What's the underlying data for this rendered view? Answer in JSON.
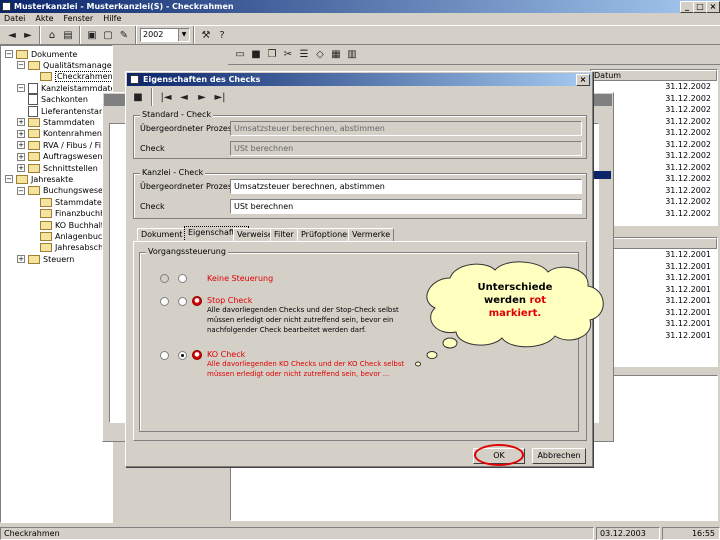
{
  "app": {
    "title": "Musterkanzlei - Musterkanzlei(S) - Checkrahmen",
    "menu": [
      "Datei",
      "Akte",
      "Fenster",
      "Hilfe"
    ],
    "year_select": "2002",
    "window_controls": [
      "_",
      "□",
      "×"
    ]
  },
  "tree": [
    {
      "label": "Dokumente",
      "level": 0,
      "type": "folder",
      "exp": "−"
    },
    {
      "label": "Qualitätsmanagement",
      "level": 1,
      "type": "folder",
      "exp": "−"
    },
    {
      "label": "Checkrahmen",
      "level": 2,
      "type": "folder",
      "exp": "",
      "selected": true
    },
    {
      "label": "Kanzleistammdaten",
      "level": 1,
      "type": "doc",
      "exp": "−"
    },
    {
      "label": "Sachkonten",
      "level": 1,
      "type": "doc",
      "exp": ""
    },
    {
      "label": "Lieferantenstamm",
      "level": 1,
      "type": "doc",
      "exp": ""
    },
    {
      "label": "Stammdaten",
      "level": 1,
      "type": "folder",
      "exp": "+"
    },
    {
      "label": "Kontenrahmen",
      "level": 1,
      "type": "folder",
      "exp": "+"
    },
    {
      "label": "RVA / Fibus / Fi",
      "level": 1,
      "type": "folder",
      "exp": "+"
    },
    {
      "label": "Auftragswesen",
      "level": 1,
      "type": "folder",
      "exp": "+"
    },
    {
      "label": "Schnittstellen",
      "level": 1,
      "type": "folder",
      "exp": "+"
    },
    {
      "label": "Jahresakte",
      "level": 0,
      "type": "folder",
      "exp": "−"
    },
    {
      "label": "Buchungswesen",
      "level": 1,
      "type": "folder",
      "exp": "−"
    },
    {
      "label": "Stammdaten",
      "level": 2,
      "type": "folder",
      "exp": ""
    },
    {
      "label": "Finanzbuchhaltung",
      "level": 2,
      "type": "folder",
      "exp": ""
    },
    {
      "label": "KO Buchhaltung",
      "level": 2,
      "type": "folder",
      "exp": ""
    },
    {
      "label": "Anlagenbuchhaltung",
      "level": 2,
      "type": "folder",
      "exp": ""
    },
    {
      "label": "Jahresabschluss",
      "level": 2,
      "type": "folder",
      "exp": ""
    },
    {
      "label": "Steuern",
      "level": 1,
      "type": "folder",
      "exp": "+"
    }
  ],
  "right_panel": {
    "column_header": "Datum",
    "dates_top": [
      "31.12.2002",
      "31.12.2002",
      "31.12.2002",
      "31.12.2002",
      "31.12.2002",
      "31.12.2002",
      "31.12.2002",
      "31.12.2002",
      "31.12.2002",
      "31.12.2002",
      "31.12.2002",
      "31.12.2002"
    ],
    "dates_bottom": [
      "31.12.2001",
      "31.12.2001",
      "31.12.2001",
      "31.12.2001",
      "31.12.2001",
      "31.12.2001",
      "31.12.2001",
      "31.12.2001"
    ]
  },
  "dialog": {
    "title": "Eigenschaften des Checks",
    "group_standard": {
      "legend": "Standard - Check",
      "label_process": "Übergeordneter Prozess",
      "value_process": "Umsatzsteuer berechnen, abstimmen",
      "label_check": "Check",
      "value_check": "USt berechnen"
    },
    "group_kanzlei": {
      "legend": "Kanzlei - Check",
      "label_process": "Übergeordneter Prozess",
      "value_process": "Umsatzsteuer berechnen, abstimmen",
      "label_check": "Check",
      "value_check": "USt berechnen"
    },
    "tabs": [
      "Dokument",
      "Eigenschaften",
      "Verweise",
      "Filter",
      "Prüfoptionen",
      "Vermerke"
    ],
    "active_tab": "Eigenschaften",
    "group_steering": {
      "legend": "Vorgangssteuerung",
      "options": [
        {
          "title": "Keine Steuerung",
          "desc": "",
          "selected": false
        },
        {
          "title": "Stop Check",
          "desc": "Alle davorliegenden Checks und der Stop-Check selbst müssen erledigt oder nicht zutreffend sein, bevor ein nachfolgender Check bearbeitet werden darf.",
          "selected": false
        },
        {
          "title": "KO Check",
          "desc": "Alle davorliegenden KO Checks und der KO Check selbst müssen erledigt oder nicht zutreffend sein, bevor ...",
          "selected": true
        }
      ]
    },
    "ok_label": "OK",
    "cancel_label": "Abbrechen"
  },
  "callout": {
    "line1": "Unterschiede",
    "line2": "werden",
    "red_word": "rot",
    "line3": "markiert."
  },
  "status": {
    "left": "Checkrahmen",
    "date": "03.12.2003",
    "time": "16:55"
  },
  "colors": {
    "title_start": "#0a246a",
    "title_end": "#a6caf0",
    "highlight_red": "#e00000",
    "callout_fill": "#ffffc0",
    "selection_blue": "#0a246a"
  }
}
